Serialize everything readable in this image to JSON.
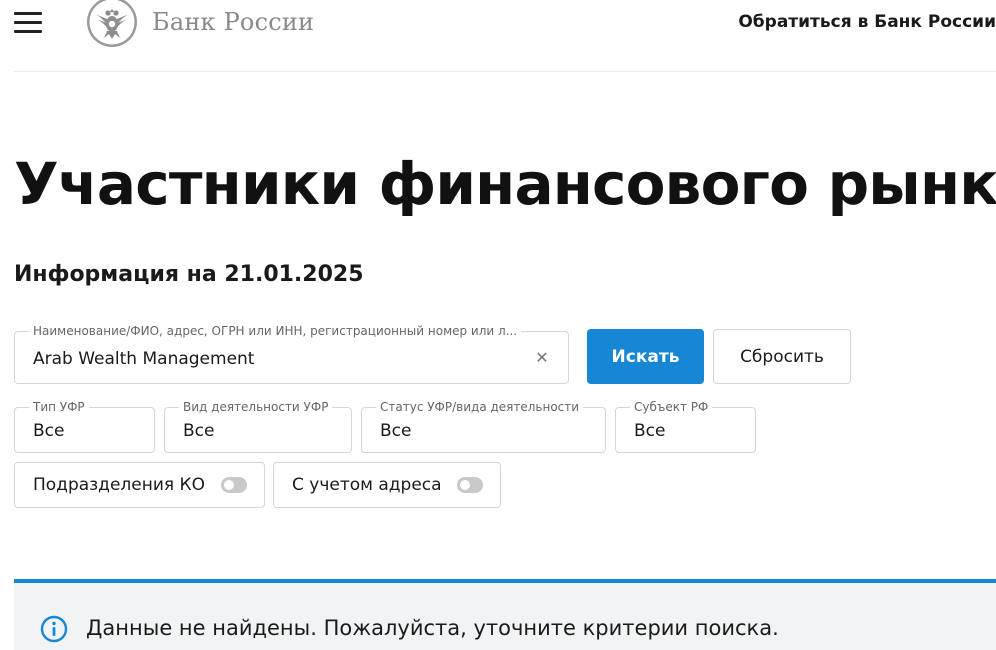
{
  "header": {
    "menu_icon": "hamburger-menu-icon",
    "logo_icon": "double-headed-eagle-emblem",
    "logo_text": "Банк России",
    "contact_link": "Обратиться в Банк России"
  },
  "page": {
    "title": "Участники финансового рынка",
    "info_date": "Информация на 21.01.2025"
  },
  "search": {
    "label": "Наименование/ФИО, адрес, ОГРН или ИНН, регистрационный номер или л...",
    "value": "Arab Wealth Management",
    "clear_icon": "close-icon",
    "search_button": "Искать",
    "reset_button": "Сбросить"
  },
  "filters": [
    {
      "label": "Тип УФР",
      "value": "Все"
    },
    {
      "label": "Вид деятельности УФР",
      "value": "Все"
    },
    {
      "label": "Статус УФР/вида деятельности",
      "value": "Все"
    },
    {
      "label": "Субъект РФ",
      "value": "Все"
    }
  ],
  "toggles": [
    {
      "label": "Подразделения КО",
      "on": false
    },
    {
      "label": "С учетом адреса",
      "on": false
    }
  ],
  "notice": {
    "icon": "info-icon",
    "text": "Данные не найдены. Пожалуйста, уточните критерии поиска."
  },
  "colors": {
    "accent": "#1687d4",
    "logo_gray": "#8a8a8a",
    "notice_bg": "#f2f3f4"
  }
}
